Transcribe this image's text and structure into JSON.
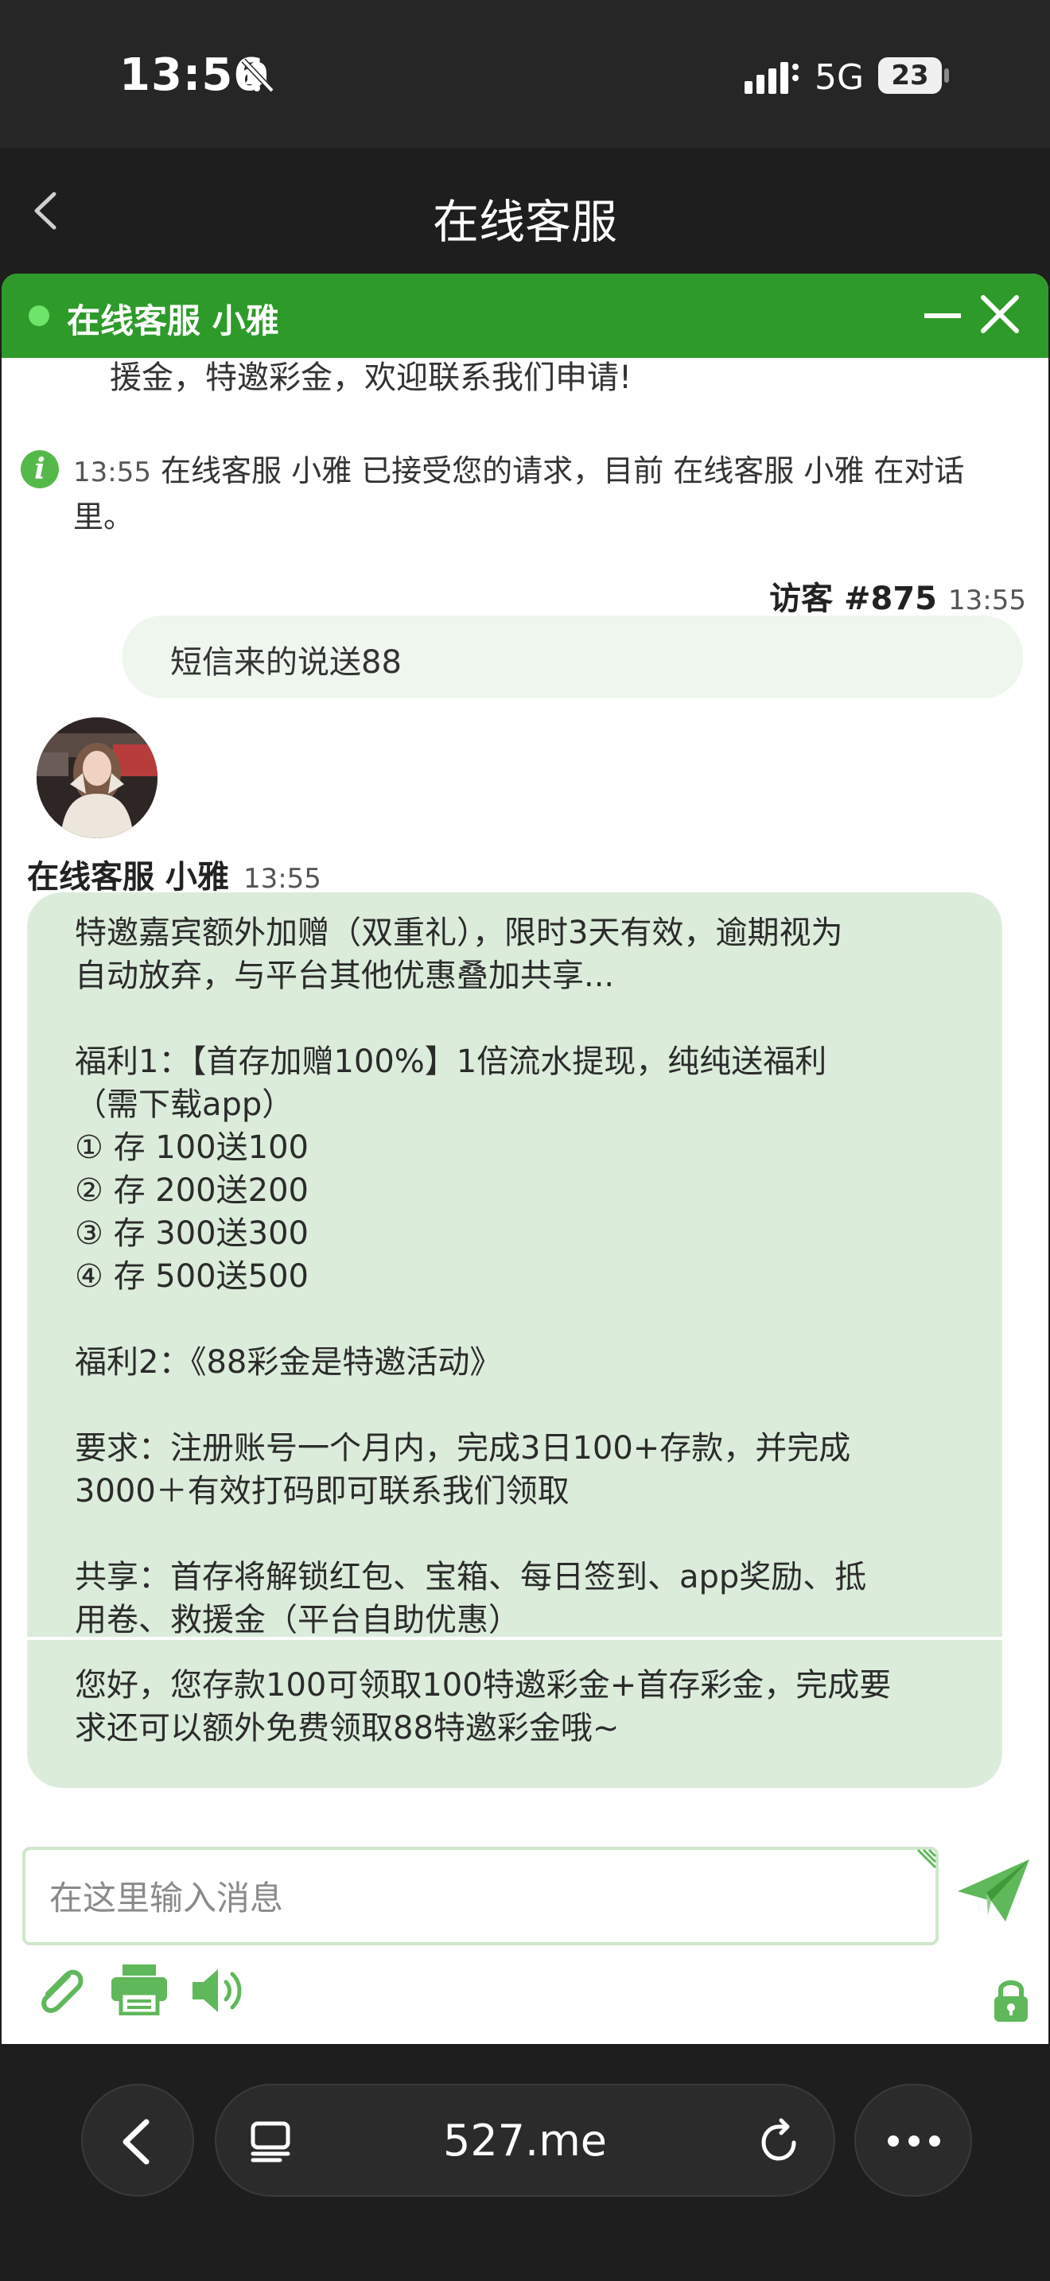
{
  "status_bar": {
    "time": "13:56",
    "network": "5G",
    "battery": "23"
  },
  "nav": {
    "title": "在线客服"
  },
  "chat_header": {
    "title": "在线客服 小雅"
  },
  "chat": {
    "truncated_message": "援金，特邀彩金，欢迎联系我们申请!",
    "system_notice": {
      "time": "13:55",
      "text": "在线客服 小雅 已接受您的请求，目前 在线客服 小雅 在对话里。"
    },
    "visitor": {
      "name": "访客 #875",
      "time": "13:55",
      "message": "短信来的说送88"
    },
    "agent": {
      "name": "在线客服 小雅",
      "time": "13:55",
      "message_lines": [
        "特邀嘉宾额外加赠（双重礼），限时3天有效，逾期视为",
        "自动放弃，与平台其他优惠叠加共享...",
        "",
        "福利1：【首存加赠100%】1倍流水提现，纯纯送福利",
        "（需下载app）",
        "① 存 100送100",
        "② 存 200送200",
        "③ 存 300送300",
        "④ 存 500送500",
        "",
        "福利2：《88彩金是特邀活动》",
        "",
        "要求：注册账号一个月内，完成3日100+存款，并完成",
        "3000＋有效打码即可联系我们领取",
        "",
        "共享：首存将解锁红包、宝箱、每日签到、app奖励、抵",
        "用卷、救援金（平台自助优惠）"
      ],
      "message2_lines": [
        "您好，您存款100可领取100特邀彩金+首存彩金，完成要",
        "求还可以额外免费领取88特邀彩金哦~"
      ]
    }
  },
  "composer": {
    "placeholder": "在这里输入消息"
  },
  "toolbar": {
    "icons": [
      "paperclip-icon",
      "printer-icon",
      "speaker-icon",
      "lock-icon"
    ]
  },
  "browser": {
    "url": "527.me"
  },
  "colors": {
    "brand_green": "#2e9a2a",
    "bubble_agent": "#dcecdb",
    "bubble_visitor": "#eef6ee"
  }
}
